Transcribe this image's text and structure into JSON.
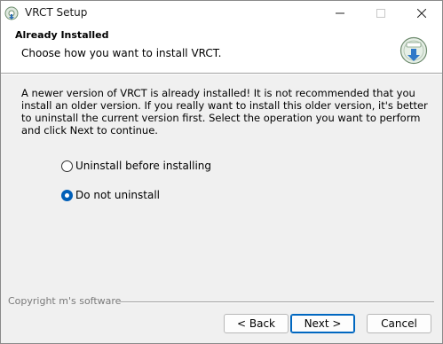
{
  "window": {
    "title": "VRCT Setup",
    "app_icon": "installer-icon",
    "controls": {
      "minimize": "minimize-icon",
      "maximize": "maximize-icon",
      "close": "close-icon"
    }
  },
  "header": {
    "title": "Already Installed",
    "subtitle": "Choose how you want to install VRCT.",
    "icon": "install-disk-icon"
  },
  "main": {
    "description": "A newer version of VRCT is already installed! It is not recommended that you install an older version. If you really want to install this older version, it's better to uninstall the current version first. Select the operation you want to perform and click Next to continue.",
    "options": [
      {
        "label": "Uninstall before installing",
        "selected": false
      },
      {
        "label": "Do not uninstall",
        "selected": true
      }
    ]
  },
  "footer": {
    "copyright": "Copyright m's software",
    "buttons": {
      "back": "< Back",
      "next": "Next >",
      "cancel": "Cancel"
    }
  },
  "colors": {
    "accent": "#005fb8",
    "panel": "#f0f0f0",
    "header": "#ffffff"
  }
}
